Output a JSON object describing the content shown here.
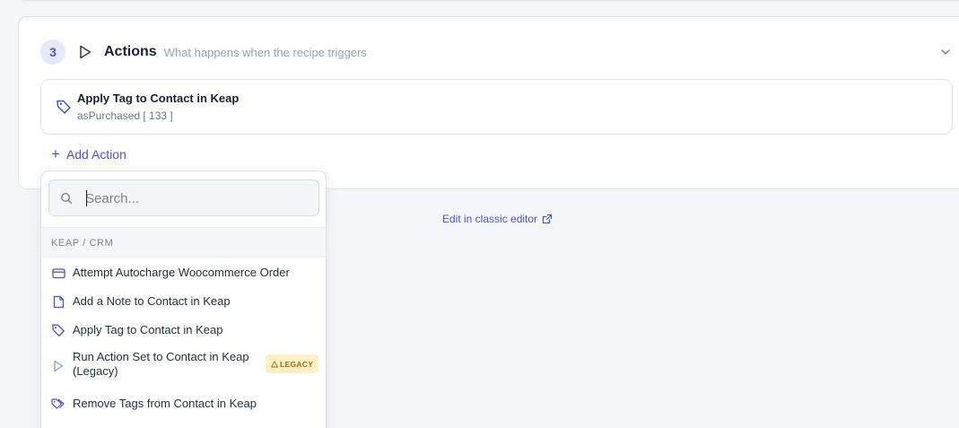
{
  "step": {
    "number": "3",
    "title": "Actions",
    "subtitle": "What happens when the recipe triggers"
  },
  "existing_action": {
    "title": "Apply Tag to Contact in Keap",
    "subtitle": "asPurchased [ 133 ]",
    "icon": "tag-icon"
  },
  "add_action_label": "Add Action",
  "classic_editor_label": "Edit in classic editor",
  "dropdown": {
    "search_placeholder": "Search...",
    "group_label": "KEAP / CRM",
    "items": [
      {
        "label": "Attempt Autocharge Woocommerce Order",
        "icon": "credit-card-icon"
      },
      {
        "label": "Add a Note to Contact in Keap",
        "icon": "note-icon"
      },
      {
        "label": "Apply Tag to Contact in Keap",
        "icon": "tag-icon"
      },
      {
        "label": "Run Action Set to Contact in Keap (Legacy)",
        "icon": "play-icon",
        "badge": "LEGACY"
      },
      {
        "label": "Remove Tags from Contact in Keap",
        "icon": "tags-icon"
      }
    ]
  },
  "colors": {
    "accent": "#4b55c6",
    "badge_bg": "#fdf0c7",
    "badge_text": "#a46a08"
  }
}
